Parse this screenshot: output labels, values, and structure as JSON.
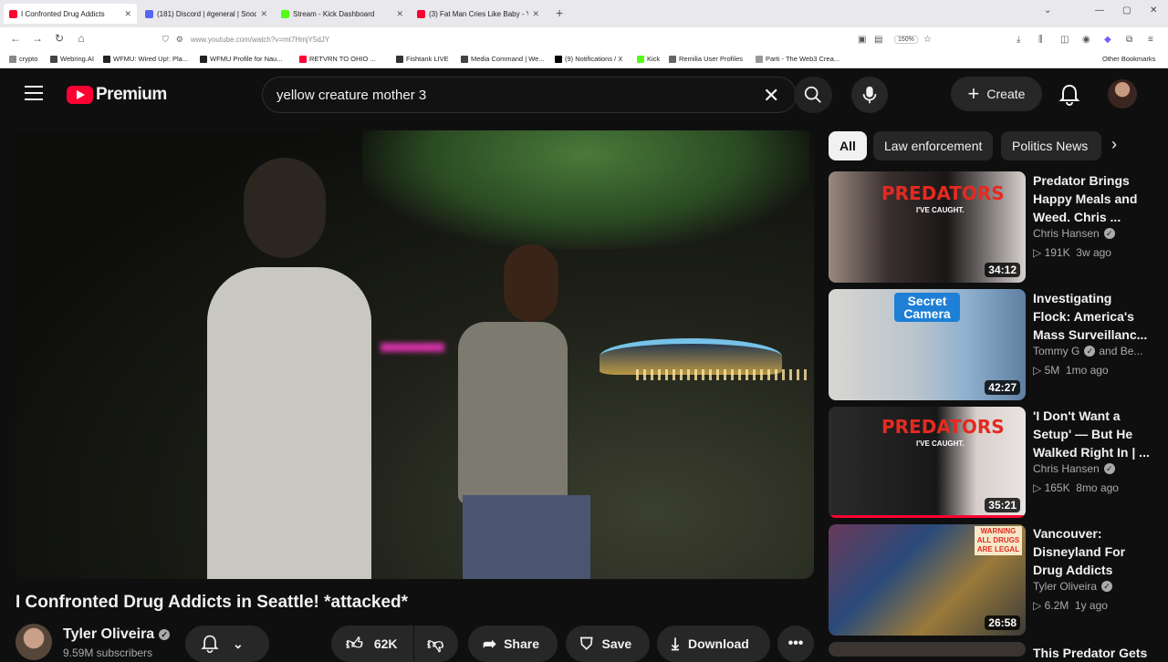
{
  "browser": {
    "tabs": [
      {
        "title": "I Confronted Drug Addicts",
        "color": "#ff0033",
        "active": true
      },
      {
        "title": "(181) Discord | #general | Snod",
        "color": "#5865f2",
        "active": false
      },
      {
        "title": "Stream - Kick Dashboard",
        "color": "#53fc18",
        "active": false
      },
      {
        "title": "(3) Fat Man Cries Like Baby - Yo",
        "color": "#ff0033",
        "active": false
      }
    ],
    "new_tab": "+",
    "url": "www.youtube.com/watch?v=mt7HmjY5dJY",
    "zoom": "150%",
    "bookmarks": [
      {
        "label": "crypto",
        "color": "#888888"
      },
      {
        "label": "Webring.AI",
        "color": "#444444"
      },
      {
        "label": "WFMU: Wired Up!: Pla...",
        "color": "#222222"
      },
      {
        "label": "WFMU Profile for Nau...",
        "color": "#222222"
      },
      {
        "label": "RETVRN TO OHIO ...",
        "color": "#ff0033"
      },
      {
        "label": "Fishtank LIVE",
        "color": "#333333"
      },
      {
        "label": "Media Command | We...",
        "color": "#444444"
      },
      {
        "label": "(9) Notifications / X",
        "color": "#000000"
      },
      {
        "label": "Kick",
        "color": "#53fc18"
      },
      {
        "label": "Remilia User Profiles",
        "color": "#666666"
      },
      {
        "label": "Parti - The Web3 Crea...",
        "color": "#999999"
      }
    ],
    "other_bookmarks": "Other Bookmarks"
  },
  "header": {
    "logo_text": "Premium",
    "search_query": "yellow creature mother 3",
    "create_label": "Create",
    "accent": "#ff0033"
  },
  "video": {
    "title": "I Confronted Drug Addicts in Seattle! *attacked*",
    "channel": "Tyler Oliveira",
    "subscribers": "9.59M subscribers",
    "likes": "62K",
    "share_label": "Share",
    "save_label": "Save",
    "download_label": "Download"
  },
  "chips": [
    "All",
    "Law enforcement",
    "Politics News"
  ],
  "recommendations": [
    {
      "title": "Predator Brings Happy Meals and Weed. Chris ...",
      "channel": "Chris Hansen",
      "verified": true,
      "views": "191K",
      "age": "3w ago",
      "duration": "34:12",
      "thumb_text": "PREDATORS",
      "thumb_sub": "I'VE CAUGHT."
    },
    {
      "title": "Investigating Flock: America's Mass Surveillanc...",
      "channel": "Tommy G",
      "channel_extra": "and Be...",
      "verified": true,
      "views": "5M",
      "age": "1mo ago",
      "duration": "42:27",
      "thumb_text": "Secret Camera"
    },
    {
      "title": "'I Don't Want a Setup' — But He Walked Right In | ...",
      "channel": "Chris Hansen",
      "verified": true,
      "views": "165K",
      "age": "8mo ago",
      "duration": "35:21",
      "thumb_text": "PREDATORS",
      "thumb_sub": "I'VE CAUGHT.",
      "watched": true
    },
    {
      "title": "Vancouver: Disneyland For Drug Addicts",
      "channel": "Tyler Oliveira",
      "verified": true,
      "views": "6.2M",
      "age": "1y ago",
      "duration": "26:58",
      "thumb_text": "WARNING ALL DRUGS ARE LEGAL"
    },
    {
      "title": "This Predator Gets"
    }
  ]
}
